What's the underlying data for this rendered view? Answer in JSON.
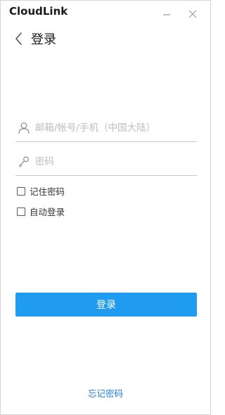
{
  "window": {
    "app_title": "CloudLink"
  },
  "header": {
    "title": "登录"
  },
  "form": {
    "account_placeholder": "邮箱/帐号/手机（中国大陆）",
    "account_value": "",
    "password_placeholder": "密码",
    "password_value": "",
    "remember_label": "记住密码",
    "remember_checked": false,
    "autologin_label": "自动登录",
    "autologin_checked": false
  },
  "actions": {
    "login_label": "登录",
    "forgot_label": "忘记密码"
  },
  "icons": {
    "minimize": "minimize-icon",
    "close": "close-icon",
    "back": "chevron-left-icon",
    "account": "user-icon",
    "password": "key-icon"
  },
  "colors": {
    "primary_button": "#1f9bf0",
    "link": "#1f7fd6",
    "placeholder": "#bdbdbd"
  }
}
